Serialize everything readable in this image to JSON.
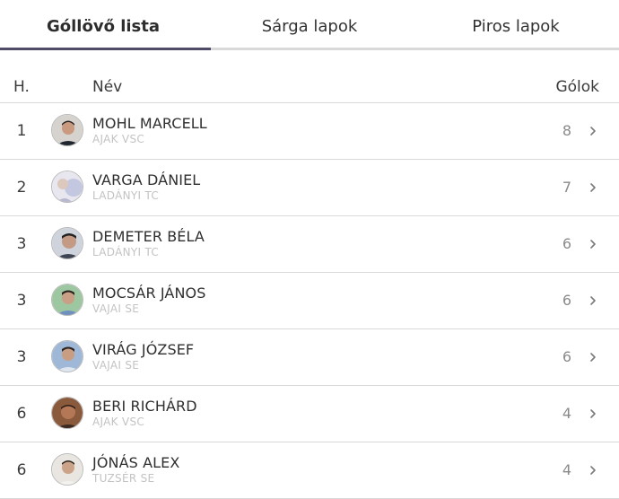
{
  "tabs": [
    {
      "label": "Góllövő lista",
      "active": true
    },
    {
      "label": "Sárga lapok",
      "active": false
    },
    {
      "label": "Piros lapok",
      "active": false
    }
  ],
  "table": {
    "headers": {
      "rank": "H.",
      "name": "Név",
      "goals": "Gólok"
    },
    "rows": [
      {
        "rank": "1",
        "name": "MOHL MARCELL",
        "club": "AJAK VSC",
        "goals": "8"
      },
      {
        "rank": "2",
        "name": "VARGA DÁNIEL",
        "club": "LADÁNYI TC",
        "goals": "7"
      },
      {
        "rank": "3",
        "name": "DEMETER BÉLA",
        "club": "LADÁNYI TC",
        "goals": "6"
      },
      {
        "rank": "3",
        "name": "MOCSÁR JÁNOS",
        "club": "VAJAI SE",
        "goals": "6"
      },
      {
        "rank": "3",
        "name": "VIRÁG JÓZSEF",
        "club": "VAJAI SE",
        "goals": "6"
      },
      {
        "rank": "6",
        "name": "BERI RICHÁRD",
        "club": "AJAK VSC",
        "goals": "4"
      },
      {
        "rank": "6",
        "name": "JÓNÁS ALEX",
        "club": "TUZSÉR SE",
        "goals": "4"
      }
    ]
  },
  "icons": {
    "row_action": "chevron-right-icon"
  },
  "colors": {
    "accent": "#4f4a66",
    "divider": "#d9d9d9",
    "club_text": "#c3c3c3",
    "goals_text": "#8a8a8a"
  }
}
